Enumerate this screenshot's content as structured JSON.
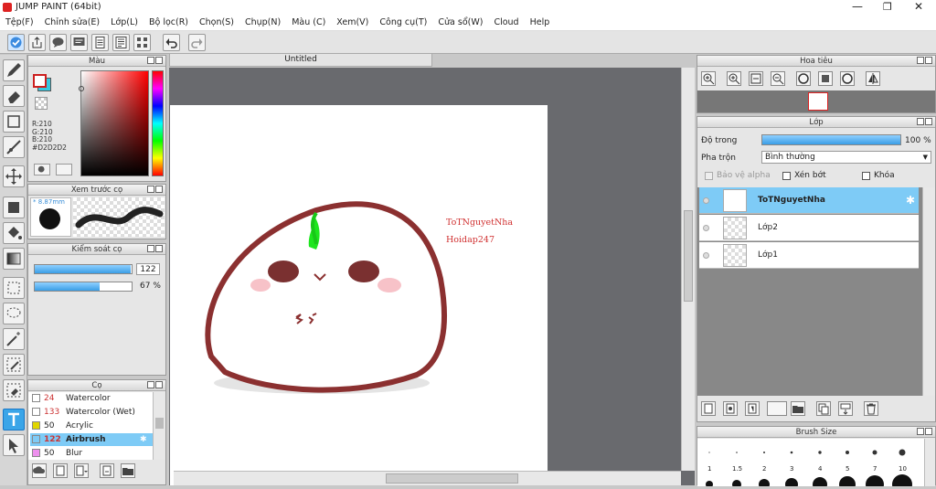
{
  "app": {
    "title": "JUMP PAINT (64bit)"
  },
  "menu": [
    "Tệp(F)",
    "Chỉnh sửa(E)",
    "Lớp(L)",
    "Bộ lọc(R)",
    "Chọn(S)",
    "Chụp(N)",
    "Màu (C)",
    "Xem(V)",
    "Công cụ(T)",
    "Cửa sổ(W)",
    "Cloud",
    "Help"
  ],
  "color_panel": {
    "title": "Màu",
    "r": "R:210",
    "g": "G:210",
    "b": "B:210",
    "hex": "#D2D2D2",
    "primary": "#cc1f1f",
    "secondary": "#34c8e0"
  },
  "brush_preview": {
    "title": "Xem trước cọ",
    "size": "8.87mm"
  },
  "brush_control": {
    "title": "Kiểm soát cọ",
    "size_value": "122",
    "opacity_value": "67",
    "opacity_unit": "%",
    "size_fraction": 0.99,
    "opacity_fraction": 0.67
  },
  "brushes": {
    "title": "Cọ",
    "items": [
      {
        "num": "24",
        "name": "Watercolor",
        "color": "#ffffff"
      },
      {
        "num": "133",
        "name": "Watercolor (Wet)",
        "color": "#ffffff"
      },
      {
        "num": "50",
        "name": "Acrylic",
        "color": "#e0d600"
      },
      {
        "num": "122",
        "name": "Airbrush",
        "color": "#ffffff",
        "selected": true
      },
      {
        "num": "50",
        "name": "Blur",
        "color": "#ee90ee"
      }
    ]
  },
  "document": {
    "tab": "Untitled",
    "text1": "ToTNguyetNha",
    "text2": "Hoidap247"
  },
  "navigator": {
    "title": "Hoa tiêu"
  },
  "layers": {
    "title": "Lớp",
    "opacity_label": "Độ trong",
    "opacity_value": "100",
    "opacity_unit": "%",
    "opacity_fraction": 1.0,
    "blend_label": "Pha trộn",
    "blend_value": "Bình thường",
    "protect_alpha": "Bảo vệ alpha",
    "clipping": "Xén bớt",
    "lock": "Khóa",
    "items": [
      {
        "name": "ToTNguyetNha",
        "selected": true
      },
      {
        "name": "Lớp2",
        "selected": false
      },
      {
        "name": "Lớp1",
        "selected": false
      }
    ]
  },
  "brush_size": {
    "title": "Brush Size",
    "labels": [
      "1",
      "1.5",
      "2",
      "3",
      "4",
      "5",
      "7",
      "10"
    ]
  }
}
